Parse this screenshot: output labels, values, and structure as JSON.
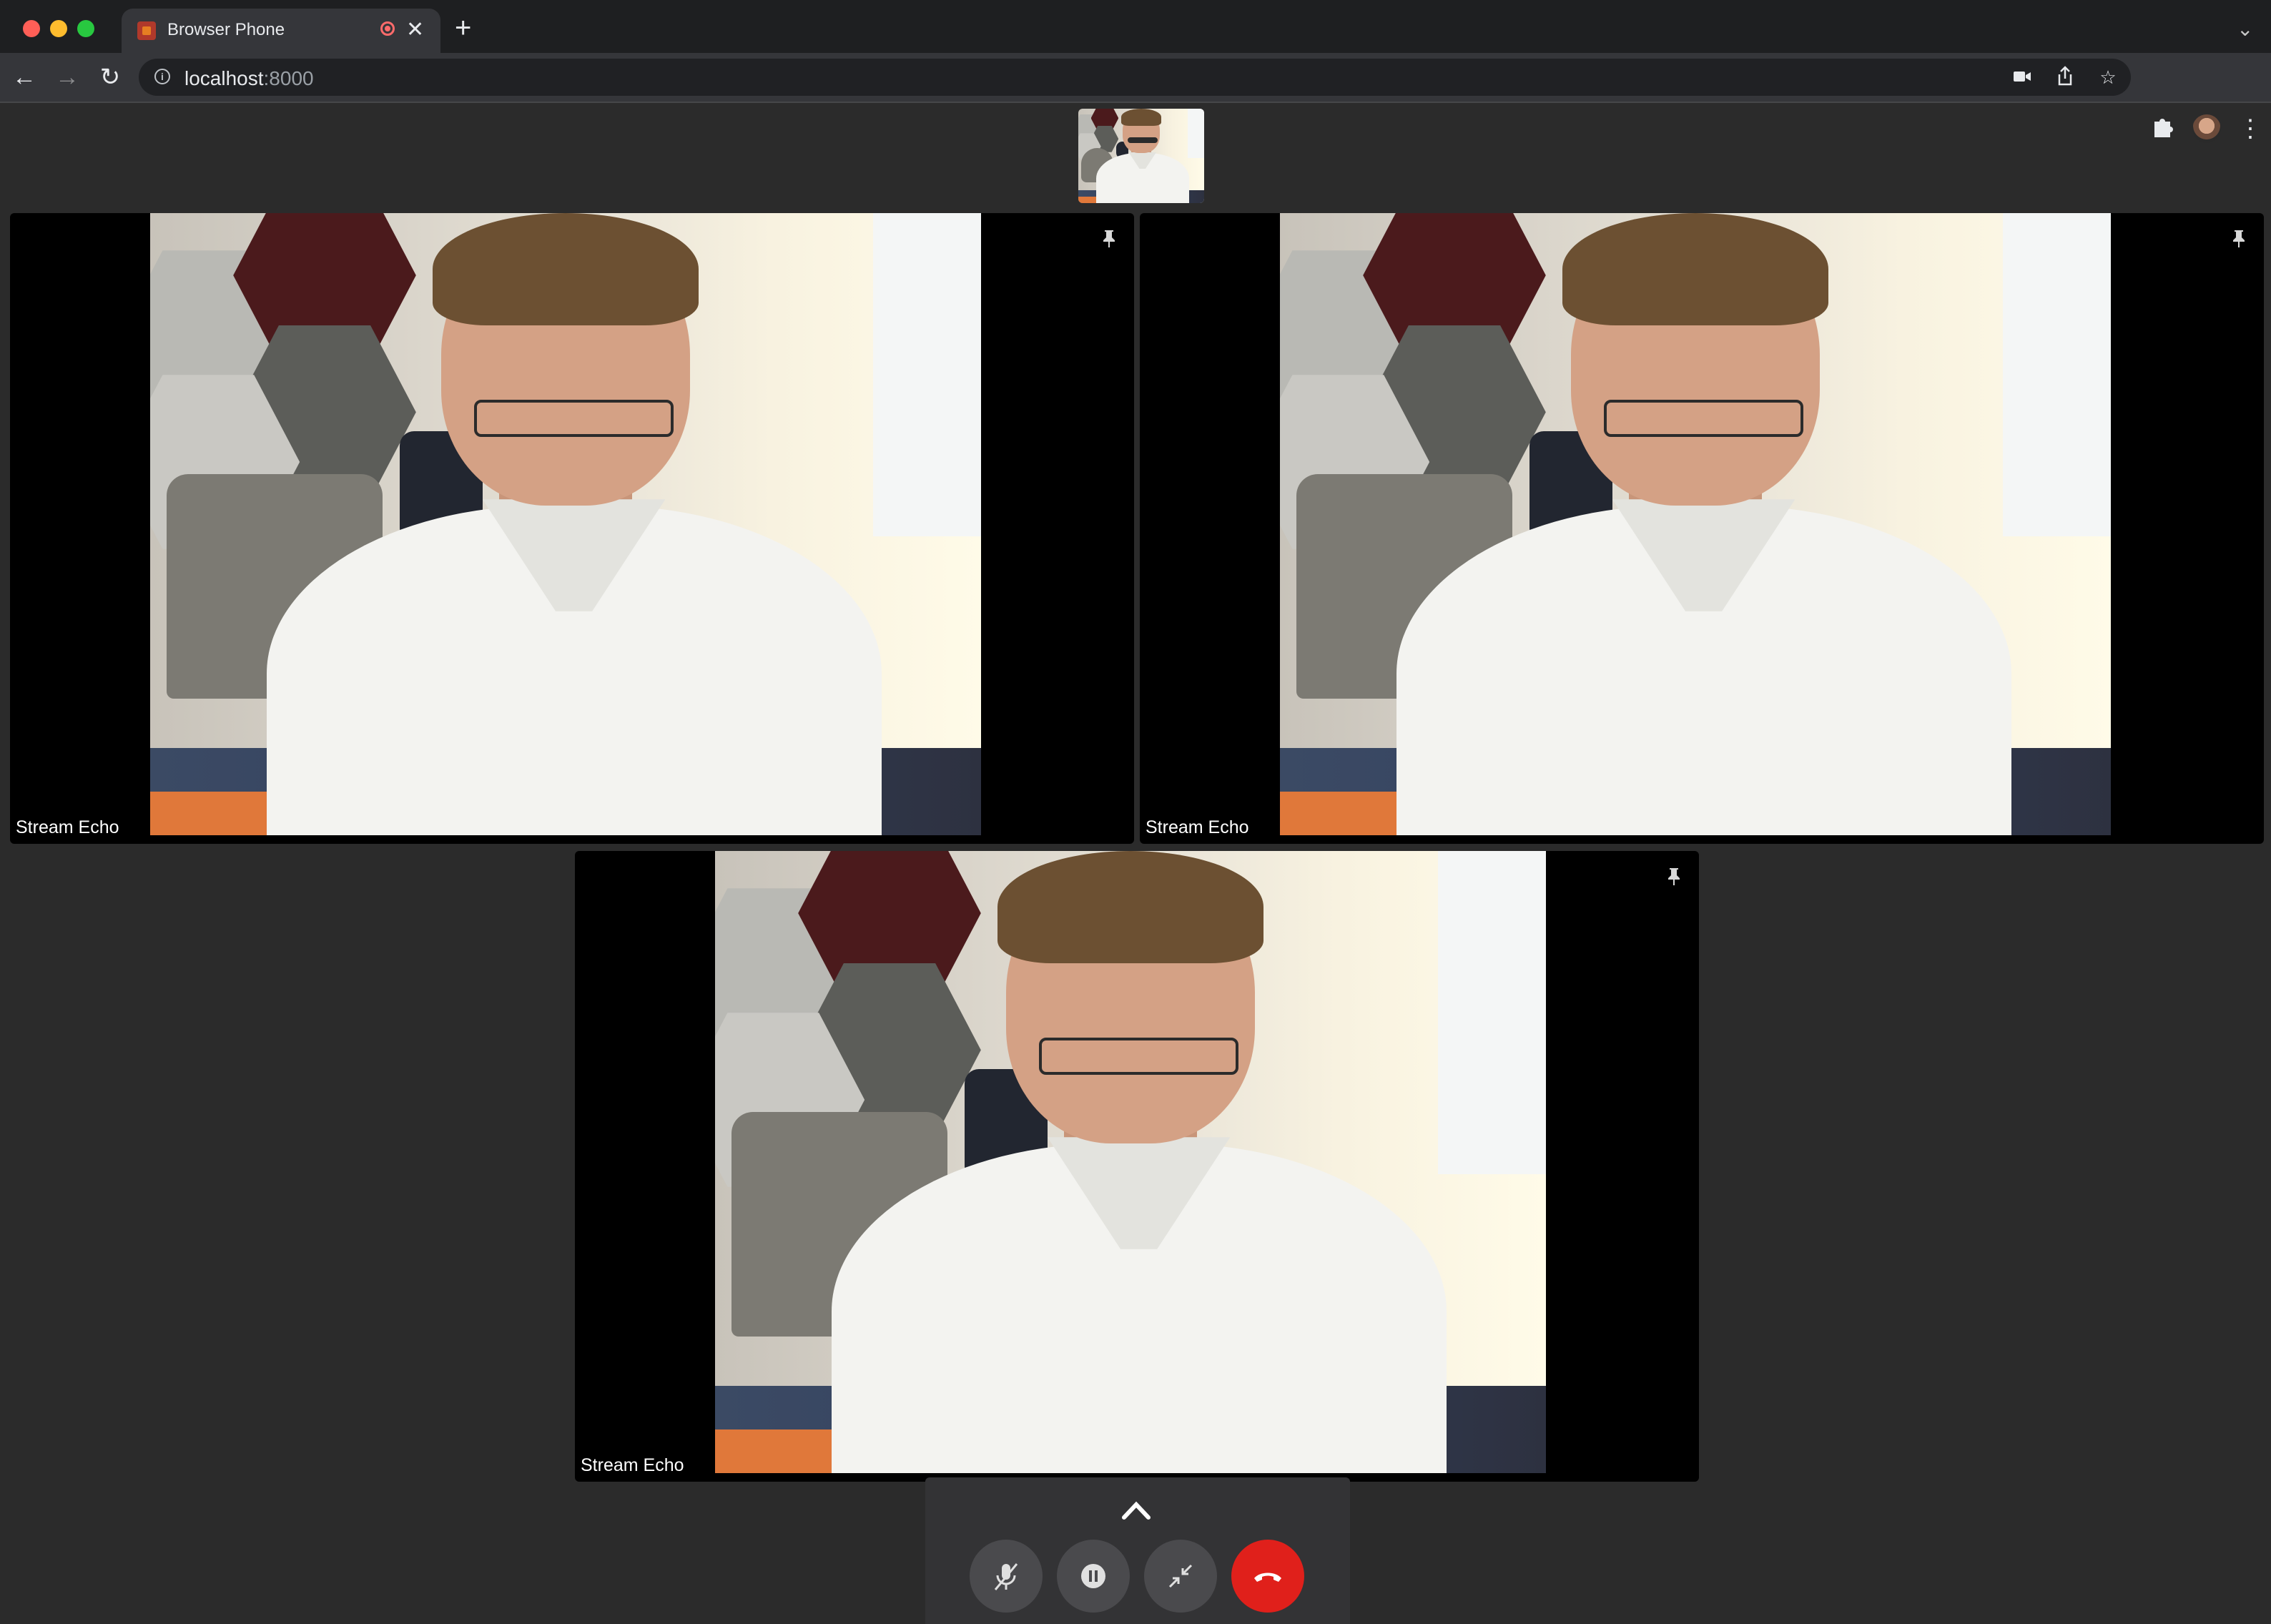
{
  "browser": {
    "tab_title": "Browser Phone",
    "url_host": "localhost",
    "url_port": ":8000",
    "icons": [
      "back-icon",
      "forward-icon",
      "reload-icon",
      "info-icon",
      "camera-icon",
      "share-icon",
      "star-icon",
      "extensions-icon",
      "profile-avatar",
      "menu-icon",
      "new-tab-icon",
      "tab-close-icon",
      "recording-icon",
      "tab-list-icon"
    ]
  },
  "call": {
    "tiles": [
      {
        "label": "Stream Echo"
      },
      {
        "label": "Stream Echo"
      },
      {
        "label": "Stream Echo"
      }
    ],
    "controls": {
      "icons": [
        "chevron-up-icon",
        "mic-muted-icon",
        "pause-icon",
        "minimize-icon",
        "hangup-icon"
      ],
      "end_color": "#e0201b"
    }
  }
}
